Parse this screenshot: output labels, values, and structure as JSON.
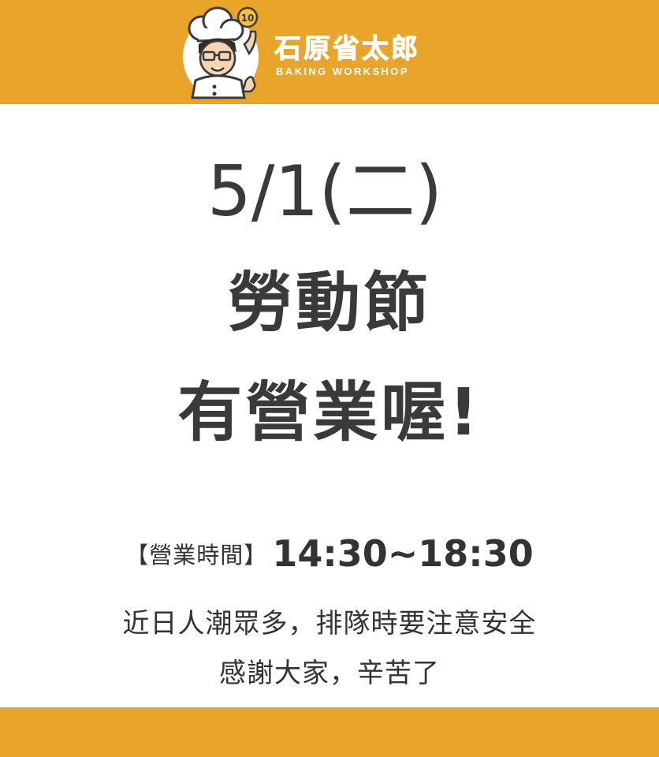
{
  "brand": {
    "name": "石原省太郎",
    "subtitle": "BAKING WORKSHOP",
    "badge_number": "10",
    "color": "#e9a52a"
  },
  "announcement": {
    "date": "5/1(二)",
    "holiday": "勞動節",
    "status": "有營業喔!"
  },
  "hours": {
    "label": "【營業時間】",
    "value": "14:30~18:30"
  },
  "notices": [
    "近日人潮眾多，排隊時要注意安全",
    "感謝大家，辛苦了"
  ]
}
